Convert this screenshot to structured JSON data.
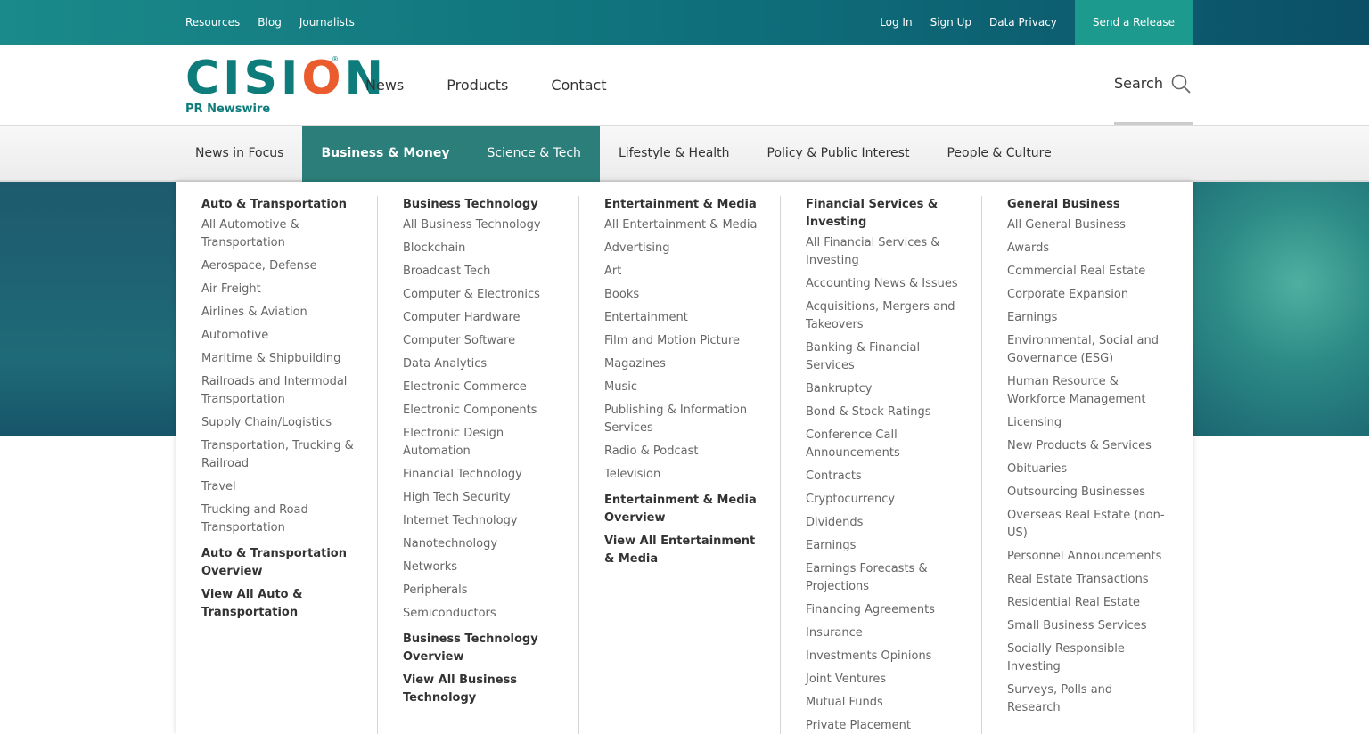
{
  "topbar": {
    "left": [
      "Resources",
      "Blog",
      "Journalists"
    ],
    "right": [
      "Log In",
      "Sign Up",
      "Data Privacy"
    ],
    "release": "Send a Release"
  },
  "logo": {
    "word_a": "CISI",
    "word_o": "O",
    "word_b": "N",
    "reg": "®",
    "sub": "PR Newswire"
  },
  "main_nav": [
    "News",
    "Products",
    "Contact"
  ],
  "search": {
    "label": "Search"
  },
  "categories": [
    "News in Focus",
    "Business & Money",
    "Science & Tech",
    "Lifestyle & Health",
    "Policy & Public Interest",
    "People & Culture"
  ],
  "columns": [
    {
      "heading": "Auto & Transportation",
      "links": [
        "All Automotive & Transportation",
        "Aerospace, Defense",
        "Air Freight",
        "Airlines & Aviation",
        "Automotive",
        "Maritime & Shipbuilding",
        "Railroads and Intermodal Transportation",
        "Supply Chain/Logistics",
        "Transportation, Trucking & Railroad",
        "Travel",
        "Trucking and Road Transportation"
      ],
      "overview": [
        "Auto & Transportation Overview",
        "View All Auto & Transportation"
      ]
    },
    {
      "heading": "Business Technology",
      "links": [
        "All Business Technology",
        "Blockchain",
        "Broadcast Tech",
        "Computer & Electronics",
        "Computer Hardware",
        "Computer Software",
        "Data Analytics",
        "Electronic Commerce",
        "Electronic Components",
        "Electronic Design Automation",
        "Financial Technology",
        "High Tech Security",
        "Internet Technology",
        "Nanotechnology",
        "Networks",
        "Peripherals",
        "Semiconductors"
      ],
      "overview": [
        "Business Technology Overview",
        "View All Business Technology"
      ]
    },
    {
      "heading": "Entertainment & Media",
      "links": [
        "All Entertainment & Media",
        "Advertising",
        "Art",
        "Books",
        "Entertainment",
        "Film and Motion Picture",
        "Magazines",
        "Music",
        "Publishing & Information Services",
        "Radio & Podcast",
        "Television"
      ],
      "overview": [
        "Entertainment & Media Overview",
        "View All Entertainment & Media"
      ]
    },
    {
      "heading": "Financial Services & Investing",
      "links": [
        "All Financial Services & Investing",
        "Accounting News & Issues",
        "Acquisitions, Mergers and Takeovers",
        "Banking & Financial Services",
        "Bankruptcy",
        "Bond & Stock Ratings",
        "Conference Call Announcements",
        "Contracts",
        "Cryptocurrency",
        "Dividends",
        "Earnings",
        "Earnings Forecasts & Projections",
        "Financing Agreements",
        "Insurance",
        "Investments Opinions",
        "Joint Ventures",
        "Mutual Funds",
        "Private Placement"
      ],
      "overview": []
    },
    {
      "heading": "General Business",
      "links": [
        "All General Business",
        "Awards",
        "Commercial Real Estate",
        "Corporate Expansion",
        "Earnings",
        "Environmental, Social and Governance (ESG)",
        "Human Resource & Workforce Management",
        "Licensing",
        "New Products & Services",
        "Obituaries",
        "Outsourcing Businesses",
        "Overseas Real Estate (non-US)",
        "Personnel Announcements",
        "Real Estate Transactions",
        "Residential Real Estate",
        "Small Business Services",
        "Socially Responsible Investing",
        "Surveys, Polls and Research"
      ],
      "overview": []
    }
  ]
}
